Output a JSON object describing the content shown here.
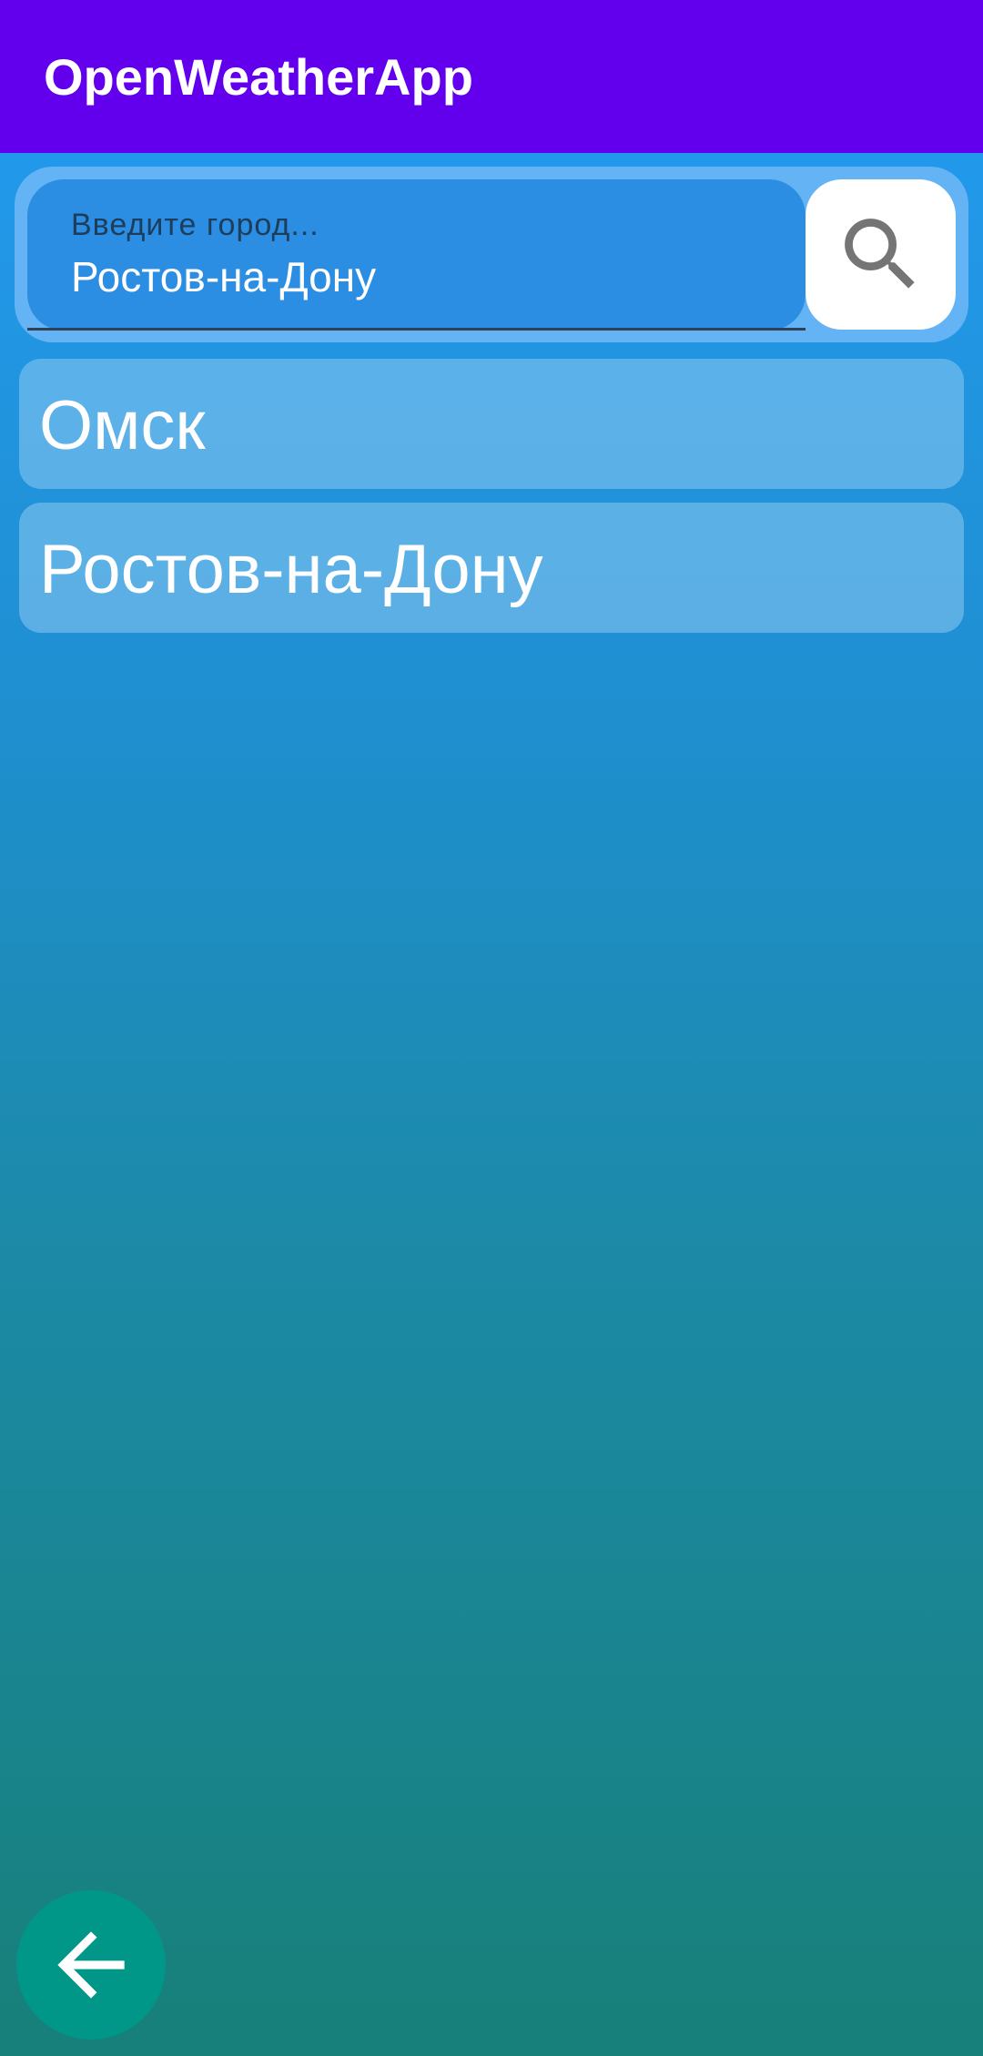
{
  "app_bar": {
    "title": "OpenWeatherApp"
  },
  "search": {
    "hint": "Введите город...",
    "value": "Ростов-на-Дону",
    "button_icon": "search-icon"
  },
  "cities": [
    {
      "label": "Омск"
    },
    {
      "label": "Ростов-на-Дону"
    }
  ],
  "fab": {
    "icon": "arrow-back-icon"
  },
  "colors": {
    "app_bar": "#6200ee",
    "gradient_top": "#239bf2",
    "gradient_bottom": "#178079",
    "fab": "#009688",
    "search_field": "#2b8ee2",
    "search_container": "#64b4f5"
  }
}
